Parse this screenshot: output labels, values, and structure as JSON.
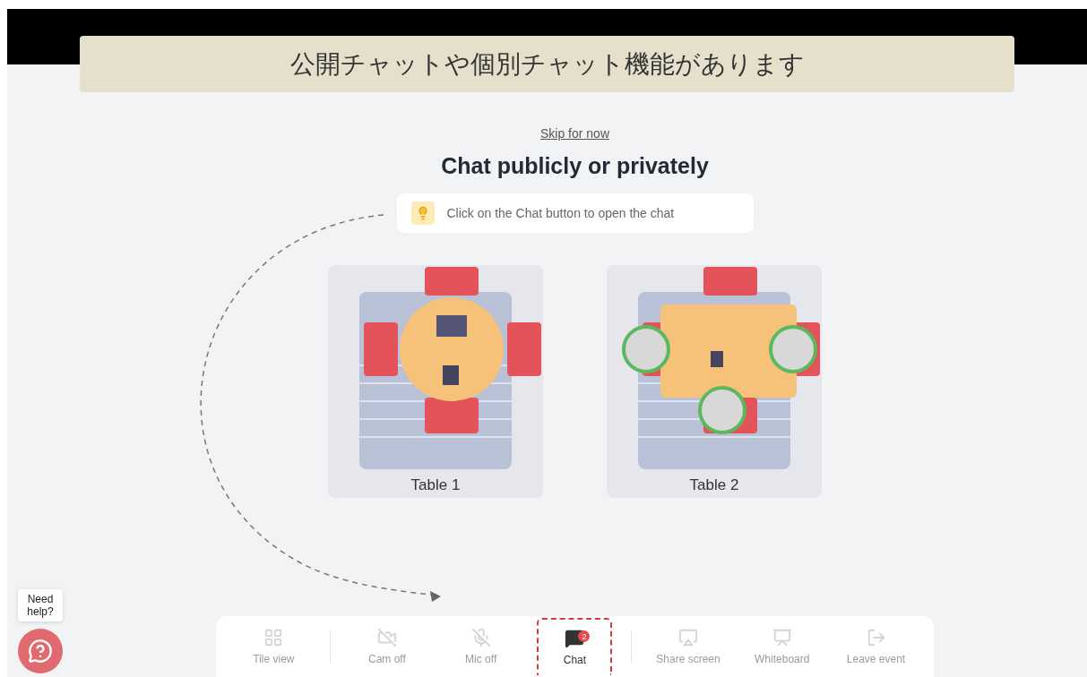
{
  "banner": {
    "text": "公開チャットや個別チャット機能があります"
  },
  "skip_link": "Skip for now",
  "title": "Chat publicly or privately",
  "hint": "Click on the Chat button to open the chat",
  "tables": [
    {
      "label": "Table 1",
      "kind": "round",
      "occupied": false
    },
    {
      "label": "Table 2",
      "kind": "rect",
      "occupied": true
    }
  ],
  "toolbar": [
    {
      "kind": "grid",
      "label": "Tile view",
      "disabled": true,
      "highlighted": false
    },
    {
      "kind": "cam",
      "label": "Cam off",
      "disabled": true,
      "highlighted": false
    },
    {
      "kind": "mic",
      "label": "Mic off",
      "disabled": true,
      "highlighted": false
    },
    {
      "kind": "chat",
      "label": "Chat",
      "disabled": false,
      "highlighted": true,
      "badge": "2"
    },
    {
      "kind": "share",
      "label": "Share screen",
      "disabled": true,
      "highlighted": false
    },
    {
      "kind": "board",
      "label": "Whiteboard",
      "disabled": true,
      "highlighted": false
    },
    {
      "kind": "leave",
      "label": "Leave event",
      "disabled": true,
      "highlighted": false
    }
  ],
  "help": {
    "tooltip": "Need help?"
  }
}
